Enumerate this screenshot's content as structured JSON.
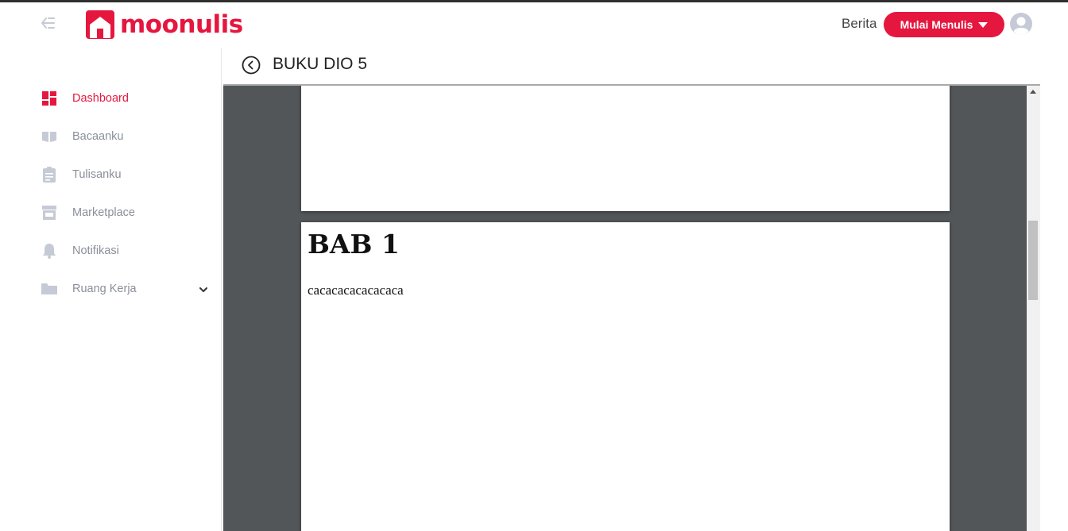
{
  "header": {
    "collapse_icon": "collapse-sidebar-icon",
    "logo_text": "moonulis",
    "berita_label": "Berita",
    "cta_label": "Mulai Menulis",
    "avatar_icon": "user-avatar-icon"
  },
  "colors": {
    "brand": "#e5173f",
    "nav_muted": "#8a8f99",
    "reader_bg": "#525659"
  },
  "sidebar": {
    "items": [
      {
        "label": "Dashboard",
        "icon": "dashboard-icon",
        "active": true
      },
      {
        "label": "Bacaanku",
        "icon": "book-open-icon",
        "active": false
      },
      {
        "label": "Tulisanku",
        "icon": "clipboard-icon",
        "active": false
      },
      {
        "label": "Marketplace",
        "icon": "store-icon",
        "active": false
      },
      {
        "label": "Notifikasi",
        "icon": "bell-icon",
        "active": false
      },
      {
        "label": "Ruang Kerja",
        "icon": "folder-icon",
        "active": false,
        "expandable": true
      }
    ]
  },
  "main": {
    "back_icon": "back-circle-icon",
    "title": "BUKU DIO 5"
  },
  "reader": {
    "chapter_title": "BAB 1",
    "chapter_body": "cacacacacacacaca"
  }
}
